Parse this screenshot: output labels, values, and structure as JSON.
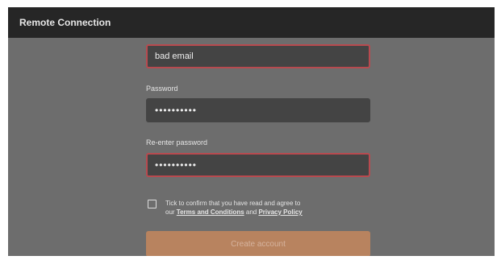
{
  "window": {
    "title": "Remote Connection"
  },
  "form": {
    "email": {
      "value": "bad email",
      "error": true
    },
    "password": {
      "label": "Password",
      "value": "••••••••••",
      "error": false
    },
    "reenter_password": {
      "label": "Re-enter password",
      "value": "••••••••••",
      "error": true
    },
    "terms": {
      "checked": false,
      "text_line1": "Tick to confirm that you have read and agree to",
      "text_prefix": "our ",
      "terms_link": "Terms and Conditions",
      "text_and": " and ",
      "privacy_link": "Privacy Policy"
    },
    "submit_label": "Create account"
  },
  "colors": {
    "titlebar": "#262626",
    "background": "#6d6d6d",
    "field": "#444444",
    "error_border": "#b84a4f",
    "button": "#b8835f"
  }
}
